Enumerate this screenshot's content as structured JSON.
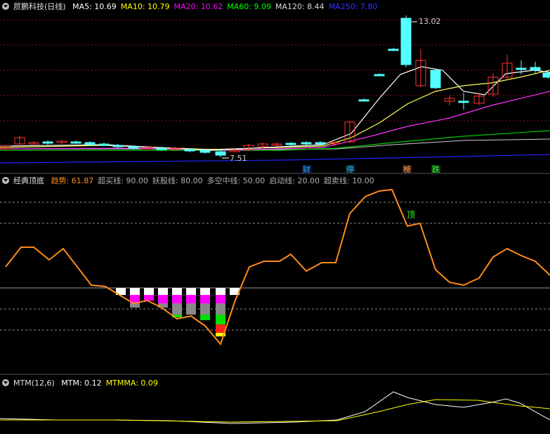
{
  "panel1": {
    "title": "屃鹏科技(日线)",
    "ma": [
      {
        "label": "MA5: 10.69",
        "color": "#ffffff"
      },
      {
        "label": "MA10: 10.79",
        "color": "#ffff00"
      },
      {
        "label": "MA20: 10.62",
        "color": "#ff00ff"
      },
      {
        "label": "MA60: 9.09",
        "color": "#00ff00"
      },
      {
        "label": "MA120: 8.44",
        "color": "#d8d8d8"
      },
      {
        "label": "MA250: 7.80",
        "color": "#3333ff"
      }
    ],
    "high_label": "13.02",
    "low_label": "7.51",
    "tags": [
      {
        "text": "财",
        "color": "#33aaff",
        "bg": "#0a1a3a"
      },
      {
        "text": "停",
        "color": "#33aaff",
        "bg": "#0a2a2a"
      },
      {
        "text": "榜",
        "color": "#ffaa66",
        "bg": "#3a1a0a"
      },
      {
        "text": "跌",
        "color": "#33ff33",
        "bg": "#0a3a0a"
      }
    ]
  },
  "panel2": {
    "title": "经典顶底",
    "items": [
      {
        "label": "趋势: 61.87",
        "color": "#ff8c1a"
      },
      {
        "label": "超买线: 90.00",
        "color": "#b0b0b0"
      },
      {
        "label": "妖股线: 80.00",
        "color": "#b0b0b0"
      },
      {
        "label": "多空中线: 50.00",
        "color": "#b0b0b0"
      },
      {
        "label": "启动线: 20.00",
        "color": "#b0b0b0"
      },
      {
        "label": "超卖线: 10.00",
        "color": "#b0b0b0"
      }
    ],
    "top_label": "顶",
    "top_label_color": "#33ff33",
    "trend_color": "#ff8c1a"
  },
  "panel3": {
    "title": "MTM(12,6)",
    "items": [
      {
        "label": "MTM: 0.12",
        "color": "#ffffff"
      },
      {
        "label": "MTMMA: 0.09",
        "color": "#ffff00"
      }
    ]
  }
}
